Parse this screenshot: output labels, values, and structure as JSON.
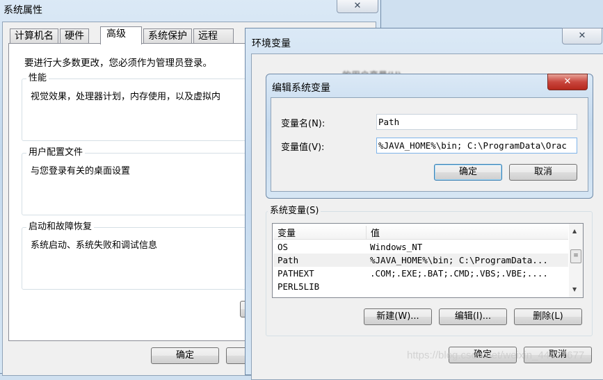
{
  "system_properties": {
    "title": "系统属性",
    "tabs": [
      {
        "label": "计算机名",
        "active": false
      },
      {
        "label": "硬件",
        "active": false
      },
      {
        "label": "高级",
        "active": true
      },
      {
        "label": "系统保护",
        "active": false
      },
      {
        "label": "远程",
        "active": false
      }
    ],
    "admin_notice": "要进行大多数更改，您必须作为管理员登录。",
    "groups": [
      {
        "label": "性能",
        "description": "视觉效果，处理器计划，内存使用，以及虚拟内"
      },
      {
        "label": "用户配置文件",
        "description": "与您登录有关的桌面设置"
      },
      {
        "label": "启动和故障恢复",
        "description": "系统启动、系统失败和调试信息"
      }
    ],
    "ok_label": "确定"
  },
  "env_vars": {
    "title": "环境变量",
    "user_vars_label": "的用户变量(U)",
    "system_vars_label": "系统变量(S)",
    "columns": [
      "变量",
      "值"
    ],
    "rows": [
      {
        "name": "OS",
        "value": "Windows_NT",
        "selected": false
      },
      {
        "name": "Path",
        "value": "%JAVA_HOME%\\bin; C:\\ProgramData...",
        "selected": true
      },
      {
        "name": "PATHEXT",
        "value": ".COM;.EXE;.BAT;.CMD;.VBS;.VBE;....",
        "selected": false
      },
      {
        "name": "PERL5LIB",
        "value": "",
        "selected": false
      }
    ],
    "new_label": "新建(W)...",
    "edit_label": "编辑(I)...",
    "delete_label": "删除(L)",
    "ok_label": "确定",
    "cancel_label": "取消"
  },
  "edit_dialog": {
    "title": "编辑系统变量",
    "name_label": "变量名(N):",
    "name_value": "Path",
    "value_label": "变量值(V):",
    "value_value": "%JAVA_HOME%\\bin; C:\\ProgramData\\Orac",
    "ok_label": "确定",
    "cancel_label": "取消"
  },
  "watermark": "https://blog.csdn.net/weixin_44477677",
  "colors": {
    "close_red": "#c9463d",
    "selection": "#f0f0f0",
    "glass": "#c4d9ee"
  }
}
